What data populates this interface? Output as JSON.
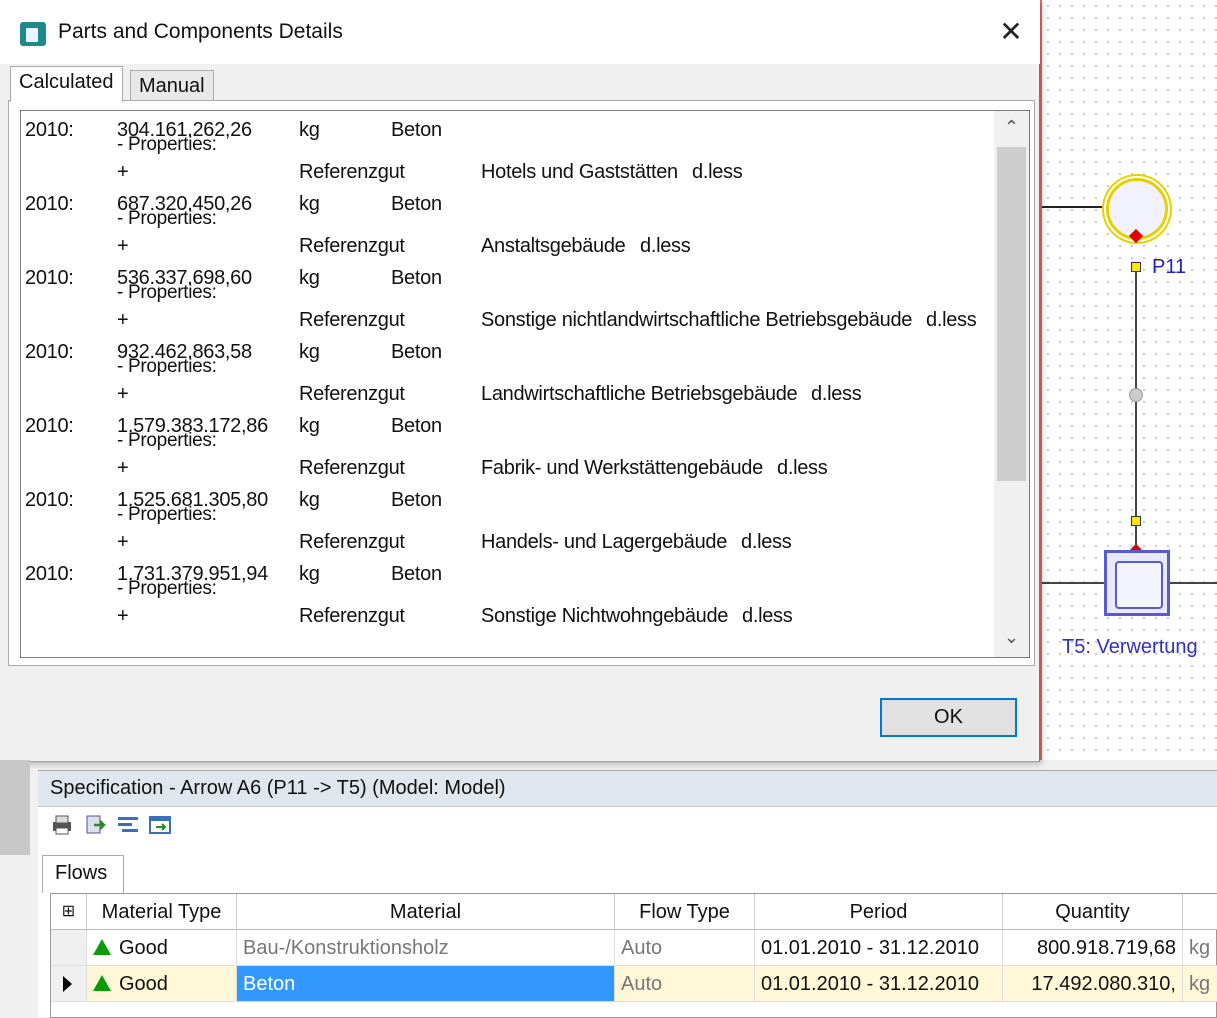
{
  "dialog": {
    "title": "Parts and Components Details",
    "close_glyph": "✕",
    "tabs": [
      "Calculated",
      "Manual"
    ],
    "ok_label": "OK"
  },
  "details": {
    "entries": [
      {
        "year": "2010:",
        "quantity": "304.161.262,26",
        "unit": "kg",
        "material": "Beton",
        "properties": "- Properties:",
        "plus": "+",
        "prop_name": "Referenzgut",
        "prop_value": "Hotels und Gaststätten",
        "prop_unit": "d.less"
      },
      {
        "year": "2010:",
        "quantity": "687.320.450,26",
        "unit": "kg",
        "material": "Beton",
        "properties": "- Properties:",
        "plus": "+",
        "prop_name": "Referenzgut",
        "prop_value": "Anstaltsgebäude",
        "prop_unit": "d.less"
      },
      {
        "year": "2010:",
        "quantity": "536.337.698,60",
        "unit": "kg",
        "material": "Beton",
        "properties": "- Properties:",
        "plus": "+",
        "prop_name": "Referenzgut",
        "prop_value": "Sonstige nichtlandwirtschaftliche Betriebsgebäude",
        "prop_unit": "d.less"
      },
      {
        "year": "2010:",
        "quantity": "932.462.863,58",
        "unit": "kg",
        "material": "Beton",
        "properties": "- Properties:",
        "plus": "+",
        "prop_name": "Referenzgut",
        "prop_value": "Landwirtschaftliche Betriebsgebäude",
        "prop_unit": "d.less"
      },
      {
        "year": "2010:",
        "quantity": "1.579.383.172,86",
        "unit": "kg",
        "material": "Beton",
        "properties": "- Properties:",
        "plus": "+",
        "prop_name": "Referenzgut",
        "prop_value": "Fabrik- und Werkstättengebäude",
        "prop_unit": "d.less"
      },
      {
        "year": "2010:",
        "quantity": "1.525.681.305,80",
        "unit": "kg",
        "material": "Beton",
        "properties": "- Properties:",
        "plus": "+",
        "prop_name": "Referenzgut",
        "prop_value": "Handels- und Lagergebäude",
        "prop_unit": "d.less"
      },
      {
        "year": "2010:",
        "quantity": "1.731.379.951,94",
        "unit": "kg",
        "material": "Beton",
        "properties": "- Properties:",
        "plus": "+",
        "prop_name": "Referenzgut",
        "prop_value": "Sonstige Nichtwohngebäude",
        "prop_unit": "d.less"
      }
    ]
  },
  "diagram": {
    "process_label": "P11",
    "transfer_label": "T5: Verwertung"
  },
  "specification": {
    "title": "Specification - Arrow A6 (P11 -> T5) (Model: Model)",
    "tab": "Flows",
    "columns": [
      "Material Type",
      "Material",
      "Flow Type",
      "Period",
      "Quantity"
    ],
    "rows": [
      {
        "material_type": "Good",
        "material": "Bau-/Konstruktionsholz",
        "flow_type": "Auto",
        "period": "01.01.2010 - 31.12.2010",
        "quantity": "800.918.719,68",
        "unit": "kg",
        "selected": false
      },
      {
        "material_type": "Good",
        "material": "Beton",
        "flow_type": "Auto",
        "period": "01.01.2010 - 31.12.2010",
        "quantity": "17.492.080.310,",
        "unit": "kg",
        "selected": true
      }
    ]
  },
  "colors": {
    "accent": "#0078d7",
    "selection": "#3399ff",
    "selected_row": "#fff8d8",
    "good_icon": "#0a9a0a"
  }
}
